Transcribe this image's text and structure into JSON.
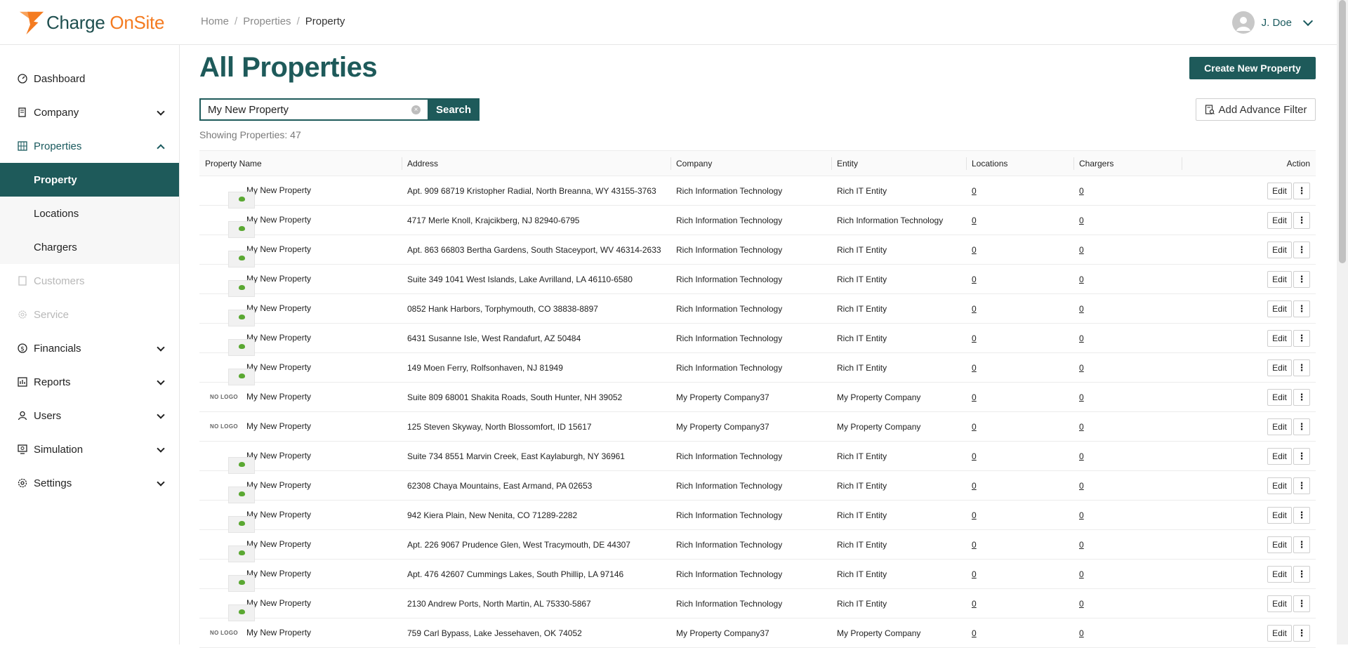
{
  "brand": {
    "name_part1": "Charge",
    "name_part2": "OnSite",
    "accent": "#f47b20",
    "primary": "#1e5a5a"
  },
  "breadcrumb": [
    "Home",
    "Properties",
    "Property"
  ],
  "user": {
    "name": "J. Doe"
  },
  "sidebar": {
    "items": [
      {
        "label": "Dashboard",
        "icon": "gauge-icon"
      },
      {
        "label": "Company",
        "icon": "building-icon"
      },
      {
        "label": "Properties",
        "icon": "grid-icon"
      },
      {
        "label": "Customers",
        "icon": "person-icon"
      },
      {
        "label": "Service",
        "icon": "gear-icon"
      },
      {
        "label": "Financials",
        "icon": "dollar-icon"
      },
      {
        "label": "Reports",
        "icon": "report-icon"
      },
      {
        "label": "Users",
        "icon": "user-icon"
      },
      {
        "label": "Simulation",
        "icon": "simulation-icon"
      },
      {
        "label": "Settings",
        "icon": "settings-icon"
      }
    ],
    "properties_sub": [
      "Property",
      "Locations",
      "Chargers"
    ]
  },
  "main": {
    "title": "All Properties",
    "create_button": "Create New Property",
    "search_value": "My New Property",
    "search_button": "Search",
    "advance_filter": "Add Advance Filter",
    "showing": "Showing Properties: 47"
  },
  "table": {
    "columns": [
      "Property Name",
      "Address",
      "Company",
      "Entity",
      "Locations",
      "Chargers",
      "Action"
    ],
    "no_logo_label": "NO LOGO",
    "edit_label": "Edit",
    "rows": [
      {
        "logo": true,
        "name": "My New Property",
        "address": "Apt. 909 68719 Kristopher Radial, North Breanna, WY 43155-3763",
        "company": "Rich Information Technology",
        "entity": "Rich IT Entity",
        "locations": "0",
        "chargers": "0"
      },
      {
        "logo": true,
        "name": "My New Property",
        "address": "4717 Merle Knoll, Krajcikberg, NJ 82940-6795",
        "company": "Rich Information Technology",
        "entity": "Rich Information Technology",
        "locations": "0",
        "chargers": "0"
      },
      {
        "logo": true,
        "name": "My New Property",
        "address": "Apt. 863 66803 Bertha Gardens, South Staceyport, WV 46314-2633",
        "company": "Rich Information Technology",
        "entity": "Rich IT Entity",
        "locations": "0",
        "chargers": "0"
      },
      {
        "logo": true,
        "name": "My New Property",
        "address": "Suite 349 1041 West Islands, Lake Avrilland, LA 46110-6580",
        "company": "Rich Information Technology",
        "entity": "Rich IT Entity",
        "locations": "0",
        "chargers": "0"
      },
      {
        "logo": true,
        "name": "My New Property",
        "address": "0852 Hank Harbors, Torphymouth, CO 38838-8897",
        "company": "Rich Information Technology",
        "entity": "Rich IT Entity",
        "locations": "0",
        "chargers": "0"
      },
      {
        "logo": true,
        "name": "My New Property",
        "address": "6431 Susanne Isle, West Randafurt, AZ 50484",
        "company": "Rich Information Technology",
        "entity": "Rich IT Entity",
        "locations": "0",
        "chargers": "0"
      },
      {
        "logo": true,
        "name": "My New Property",
        "address": "149 Moen Ferry, Rolfsonhaven, NJ 81949",
        "company": "Rich Information Technology",
        "entity": "Rich IT Entity",
        "locations": "0",
        "chargers": "0"
      },
      {
        "logo": false,
        "name": "My New Property",
        "address": "Suite 809 68001 Shakita Roads, South Hunter, NH 39052",
        "company": "My Property Company37",
        "entity": "My Property Company",
        "locations": "0",
        "chargers": "0"
      },
      {
        "logo": false,
        "name": "My New Property",
        "address": "125 Steven Skyway, North Blossomfort, ID 15617",
        "company": "My Property Company37",
        "entity": "My Property Company",
        "locations": "0",
        "chargers": "0"
      },
      {
        "logo": true,
        "name": "My New Property",
        "address": "Suite 734 8551 Marvin Creek, East Kaylaburgh, NY 36961",
        "company": "Rich Information Technology",
        "entity": "Rich IT Entity",
        "locations": "0",
        "chargers": "0"
      },
      {
        "logo": true,
        "name": "My New Property",
        "address": "62308 Chaya Mountains, East Armand, PA 02653",
        "company": "Rich Information Technology",
        "entity": "Rich IT Entity",
        "locations": "0",
        "chargers": "0"
      },
      {
        "logo": true,
        "name": "My New Property",
        "address": "942 Kiera Plain, New Nenita, CO 71289-2282",
        "company": "Rich Information Technology",
        "entity": "Rich IT Entity",
        "locations": "0",
        "chargers": "0"
      },
      {
        "logo": true,
        "name": "My New Property",
        "address": "Apt. 226 9067 Prudence Glen, West Tracymouth, DE 44307",
        "company": "Rich Information Technology",
        "entity": "Rich IT Entity",
        "locations": "0",
        "chargers": "0"
      },
      {
        "logo": true,
        "name": "My New Property",
        "address": "Apt. 476 42607 Cummings Lakes, South Phillip, LA 97146",
        "company": "Rich Information Technology",
        "entity": "Rich IT Entity",
        "locations": "0",
        "chargers": "0"
      },
      {
        "logo": true,
        "name": "My New Property",
        "address": "2130 Andrew Ports, North Martin, AL 75330-5867",
        "company": "Rich Information Technology",
        "entity": "Rich IT Entity",
        "locations": "0",
        "chargers": "0"
      },
      {
        "logo": false,
        "name": "My New Property",
        "address": "759 Carl Bypass, Lake Jessehaven, OK 74052",
        "company": "My Property Company37",
        "entity": "My Property Company",
        "locations": "0",
        "chargers": "0"
      }
    ]
  }
}
